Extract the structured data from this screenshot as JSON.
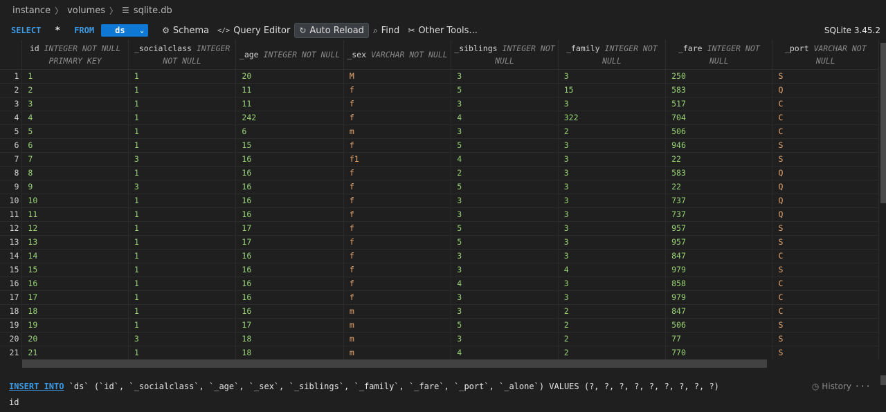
{
  "breadcrumb": {
    "items": [
      "instance",
      "volumes",
      "sqlite.db"
    ]
  },
  "toolbar": {
    "select_kw": "SELECT",
    "star": "*",
    "from_kw": "FROM",
    "table": "ds",
    "schema": "Schema",
    "query_editor": "Query Editor",
    "auto_reload": "Auto Reload",
    "find": "Find",
    "other_tools": "Other Tools...",
    "version": "SQLite 3.45.2"
  },
  "columns": [
    {
      "name": "id",
      "type": "INTEGER NOT NULL PRIMARY KEY"
    },
    {
      "name": "_socialclass",
      "type": "INTEGER NOT NULL"
    },
    {
      "name": "_age",
      "type": "INTEGER NOT NULL"
    },
    {
      "name": "_sex",
      "type": "VARCHAR NOT NULL"
    },
    {
      "name": "_siblings",
      "type": "INTEGER NOT NULL"
    },
    {
      "name": "_family",
      "type": "INTEGER NOT NULL"
    },
    {
      "name": "_fare",
      "type": "INTEGER NOT NULL"
    },
    {
      "name": "_port",
      "type": "VARCHAR NOT NULL"
    }
  ],
  "rows": [
    [
      "1",
      "1",
      "20",
      "M",
      "3",
      "3",
      "250",
      "S"
    ],
    [
      "2",
      "1",
      "11",
      "f",
      "5",
      "15",
      "583",
      "Q"
    ],
    [
      "3",
      "1",
      "11",
      "f",
      "3",
      "3",
      "517",
      "C"
    ],
    [
      "4",
      "1",
      "242",
      "f",
      "4",
      "322",
      "704",
      "C"
    ],
    [
      "5",
      "1",
      "6",
      "m",
      "3",
      "2",
      "506",
      "C"
    ],
    [
      "6",
      "1",
      "15",
      "f",
      "5",
      "3",
      "946",
      "S"
    ],
    [
      "7",
      "3",
      "16",
      "f1",
      "4",
      "3",
      "22",
      "S"
    ],
    [
      "8",
      "1",
      "16",
      "f",
      "2",
      "3",
      "583",
      "Q"
    ],
    [
      "9",
      "3",
      "16",
      "f",
      "5",
      "3",
      "22",
      "Q"
    ],
    [
      "10",
      "1",
      "16",
      "f",
      "3",
      "3",
      "737",
      "Q"
    ],
    [
      "11",
      "1",
      "16",
      "f",
      "3",
      "3",
      "737",
      "Q"
    ],
    [
      "12",
      "1",
      "17",
      "f",
      "5",
      "3",
      "957",
      "S"
    ],
    [
      "13",
      "1",
      "17",
      "f",
      "5",
      "3",
      "957",
      "S"
    ],
    [
      "14",
      "1",
      "16",
      "f",
      "3",
      "3",
      "847",
      "C"
    ],
    [
      "15",
      "1",
      "16",
      "f",
      "3",
      "4",
      "979",
      "S"
    ],
    [
      "16",
      "1",
      "16",
      "f",
      "4",
      "3",
      "858",
      "C"
    ],
    [
      "17",
      "1",
      "16",
      "f",
      "3",
      "3",
      "979",
      "C"
    ],
    [
      "18",
      "1",
      "16",
      "m",
      "3",
      "2",
      "847",
      "C"
    ],
    [
      "19",
      "1",
      "17",
      "m",
      "5",
      "2",
      "506",
      "S"
    ],
    [
      "20",
      "3",
      "18",
      "m",
      "3",
      "2",
      "77",
      "S"
    ],
    [
      "21",
      "1",
      "18",
      "m",
      "4",
      "2",
      "770",
      "S"
    ]
  ],
  "sql": {
    "insert_kw": "INSERT INTO",
    "statement": " `ds` (`id`, `_socialclass`, `_age`, `_sex`, `_siblings`, `_family`, `_fare`, `_port`, `_alone`) VALUES (?, ?, ?, ?, ?, ?, ?, ?, ?)",
    "history": "History",
    "more": "···",
    "field": "id"
  }
}
